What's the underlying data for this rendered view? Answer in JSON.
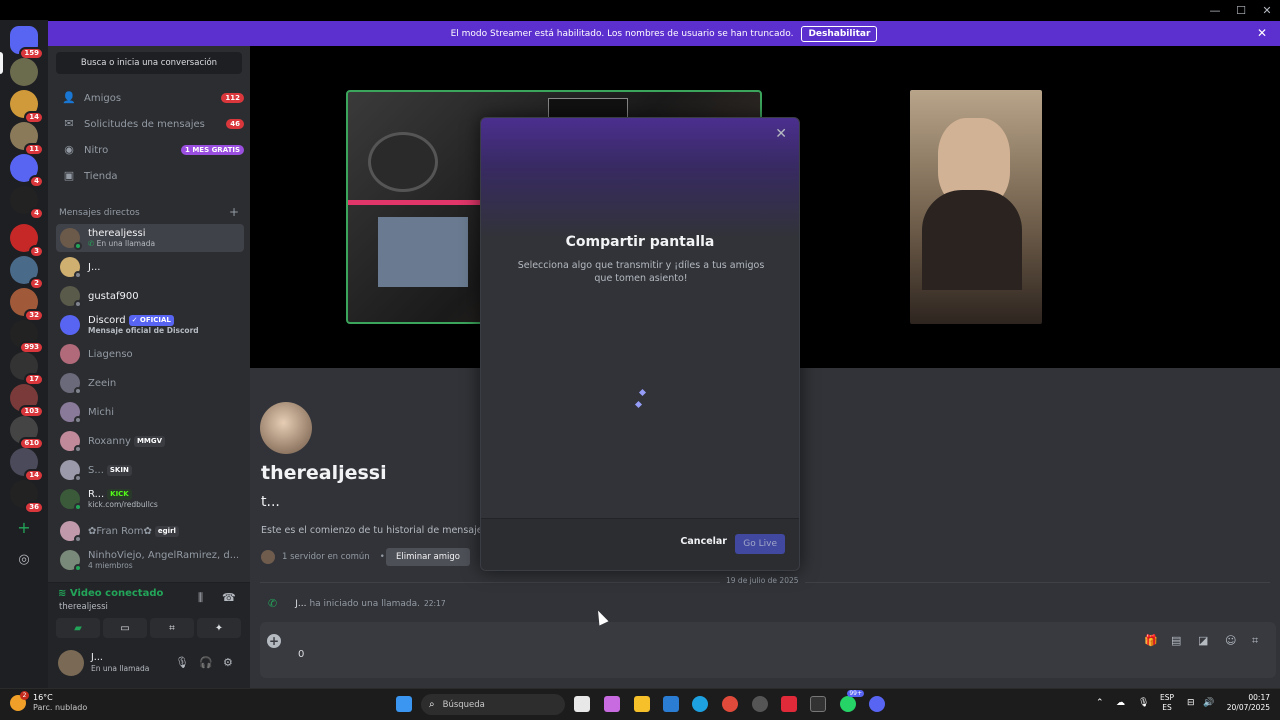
{
  "banner": {
    "text": "El modo Streamer está habilitado. Los nombres de usuario se han truncado.",
    "button": "Deshabilitar"
  },
  "servers": [
    {
      "badge": "159",
      "color": "#5865f2"
    },
    {
      "badge": "",
      "color": "#6b6b4e"
    },
    {
      "badge": "14",
      "color": "#d09a3a"
    },
    {
      "badge": "11",
      "color": "#8a7a5a"
    },
    {
      "badge": "4",
      "color": "#5865f2"
    },
    {
      "badge": "4",
      "color": "#222"
    },
    {
      "badge": "3",
      "color": "#c62828"
    },
    {
      "badge": "2",
      "color": "#4a6a8a"
    },
    {
      "badge": "32",
      "color": "#a05a3a"
    },
    {
      "badge": "993",
      "color": "#222"
    },
    {
      "badge": "17",
      "color": "#333"
    },
    {
      "badge": "103",
      "color": "#7a3a3a"
    },
    {
      "badge": "610",
      "color": "#444"
    },
    {
      "badge": "14",
      "color": "#4a4a5a"
    },
    {
      "badge": "36",
      "color": "#222"
    }
  ],
  "sidebar": {
    "search": "Busca o inicia una conversación",
    "nav": [
      {
        "label": "Amigos",
        "badge": "112",
        "icon": "friends-icon"
      },
      {
        "label": "Solicitudes de mensajes",
        "badge": "46",
        "icon": "mail-icon"
      },
      {
        "label": "Nitro",
        "badge": "1 MES GRATIS",
        "icon": "nitro-icon"
      },
      {
        "label": "Tienda",
        "badge": "",
        "icon": "shop-icon"
      }
    ],
    "dm_header": "Mensajes directos",
    "dm_add": "+",
    "dms": [
      {
        "name": "therealjessi",
        "sub": "En una llamada",
        "tag": ""
      },
      {
        "name": "J...",
        "sub": "",
        "tag": ""
      },
      {
        "name": "gustaf900",
        "sub": "",
        "tag": ""
      },
      {
        "name": "Discord",
        "sub": "Mensaje oficial de Discord",
        "tag": "✓ OFICIAL"
      },
      {
        "name": "Liagenso",
        "sub": "",
        "tag": ""
      },
      {
        "name": "Zeein",
        "sub": "",
        "tag": ""
      },
      {
        "name": "Michi",
        "sub": "",
        "tag": ""
      },
      {
        "name": "Roxanny",
        "sub": "",
        "tag": "MMGV"
      },
      {
        "name": "S...",
        "sub": "",
        "tag": "SKIN"
      },
      {
        "name": "R...",
        "sub": "kick.com/redbullcs",
        "tag": "KICK"
      },
      {
        "name": "✿Fran Rom✿",
        "sub": "",
        "tag": "egirl"
      },
      {
        "name": "NinhoViejo, AngelRamirez, d...",
        "sub": "4 miembros",
        "tag": ""
      }
    ]
  },
  "voice": {
    "title": "Video conectado",
    "channel": "therealjessi"
  },
  "user": {
    "name": "J...",
    "status": "En una llamada"
  },
  "chat": {
    "name": "therealjessi",
    "username": "t...",
    "intro": "Este es el comienzo de tu historial de mensajes directos con",
    "mutual": "1 servidor en común",
    "remove": "Eliminar amigo",
    "date": "19 de julio de 2025",
    "call_user": "J...",
    "call_text": "ha iniciado una llamada.",
    "call_time": "22:17",
    "composer_value": "0"
  },
  "modal": {
    "title": "Compartir pantalla",
    "subtitle": "Selecciona algo que transmitir y ¡díles a tus amigos que tomen asiento!",
    "cancel": "Cancelar",
    "go_live": "Go Live"
  },
  "taskbar": {
    "temp": "16°C",
    "weather": "Parc. nublado",
    "weather_badge": "2",
    "search": "Búsqueda",
    "whatsapp_badge": "99+",
    "lang1": "ESP",
    "lang2": "ES",
    "time": "00:17",
    "date": "20/07/2025"
  }
}
